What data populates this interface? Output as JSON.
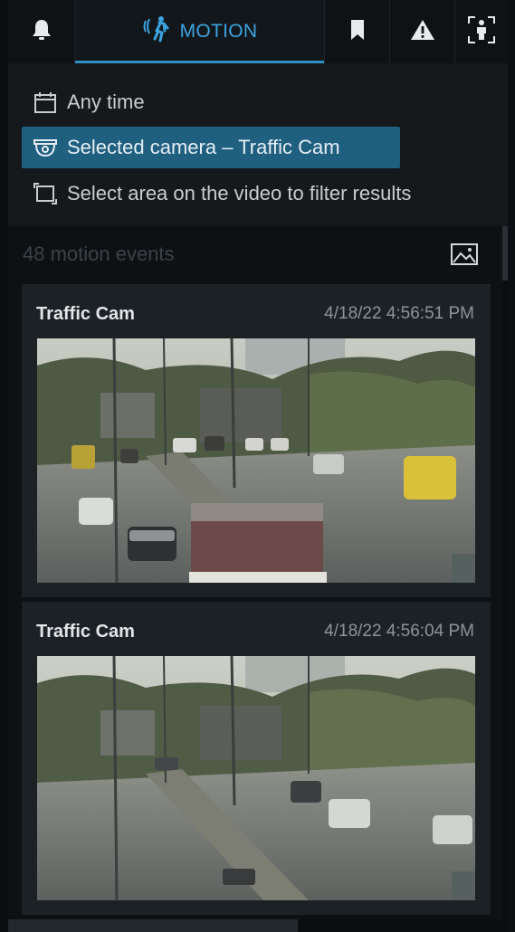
{
  "tabs": [
    {
      "name": "bell-icon"
    },
    {
      "name": "motion",
      "label": "MOTION"
    },
    {
      "name": "bookmark-icon"
    },
    {
      "name": "alert-icon"
    },
    {
      "name": "person-detect-icon"
    }
  ],
  "filters": {
    "time_label": "Any time",
    "camera_label": "Selected camera – Traffic Cam",
    "area_label": "Select area on the video to filter results"
  },
  "results": {
    "count_label": "48 motion events",
    "cards": [
      {
        "camera": "Traffic Cam",
        "timestamp": "4/18/22 4:56:51 PM"
      },
      {
        "camera": "Traffic Cam",
        "timestamp": "4/18/22 4:56:04 PM"
      }
    ]
  },
  "colors": {
    "accent": "#3ba4e0",
    "selected_filter_bg": "#1f5f80",
    "panel_bg": "#15191c",
    "card_bg": "#1c2125"
  }
}
